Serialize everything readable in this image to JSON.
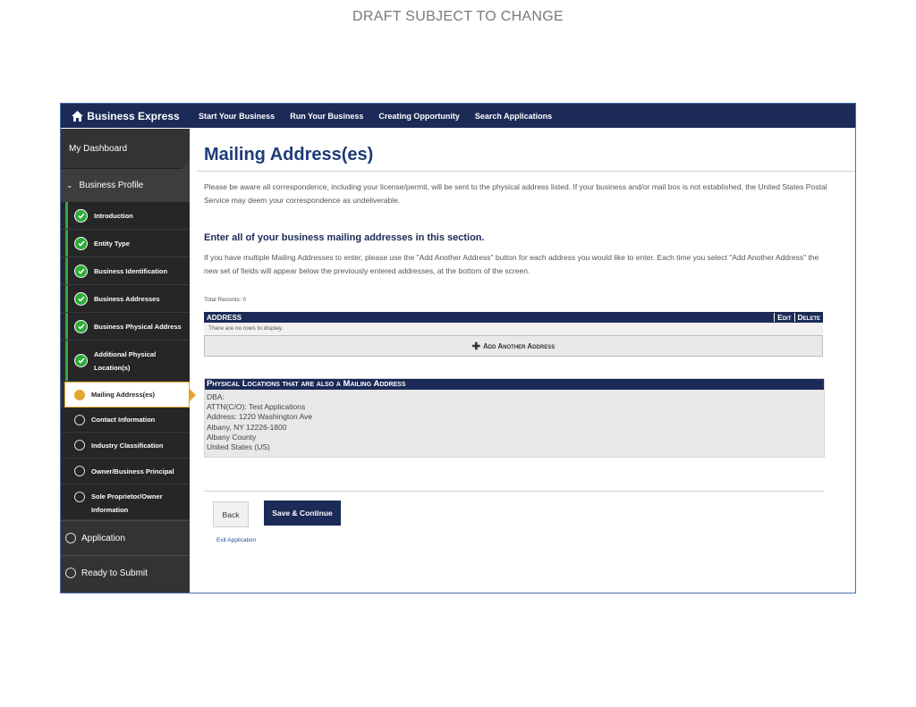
{
  "banner": "DRAFT SUBJECT TO CHANGE",
  "topnav": {
    "brand": "Business Express",
    "links": [
      "Start Your Business",
      "Run Your Business",
      "Creating Opportunity",
      "Search Applications"
    ]
  },
  "sidebar": {
    "dashboard": "My Dashboard",
    "group": "Business Profile",
    "items": [
      {
        "label": "Introduction",
        "status": "complete"
      },
      {
        "label": "Entity Type",
        "status": "complete"
      },
      {
        "label": "Business Identification",
        "status": "complete"
      },
      {
        "label": "Business Addresses",
        "status": "complete"
      },
      {
        "label": "Business Physical Address",
        "status": "complete"
      },
      {
        "label": "Additional Physical Location(s)",
        "status": "complete"
      },
      {
        "label": "Mailing Address(es)",
        "status": "current"
      },
      {
        "label": "Contact Information",
        "status": "incomplete"
      },
      {
        "label": "Industry Classification",
        "status": "incomplete"
      },
      {
        "label": "Owner/Business Principal",
        "status": "incomplete"
      },
      {
        "label": "Sole Proprietor/Owner Information",
        "status": "incomplete"
      }
    ],
    "application": "Application",
    "ready": "Ready to Submit"
  },
  "main": {
    "title": "Mailing Address(es)",
    "notice": "Please be aware all correspondence, including your license/permit, will be sent to the physical address listed. If your business and/or mail box is not established, the United States Postal Service may deem your correspondence as undeliverable.",
    "section_heading": "Enter all of your business mailing addresses in this section.",
    "instructions": "If you have multiple Mailing Addresses to enter, please use the \"Add Another Address\" button for each address you would like to enter. Each time you select \"Add Another Address\" the new set of fields will appear below the previously entered addresses, at the bottom of the screen.",
    "total_records": "Total Records: 0",
    "grid": {
      "col_address": "ADDRESS",
      "col_edit": "Edit",
      "col_delete": "Delete",
      "empty": "There are no rows to display.",
      "add_button": "Add Another Address"
    },
    "physical": {
      "heading": "Physical Locations that are also a Mailing Address",
      "lines": [
        "DBA:",
        "ATTN(C/O): Test Applications",
        "Address: 1220 Washington Ave",
        "Albany, NY 12226-1800",
        "Albany County",
        "United States (US)"
      ]
    },
    "back": "Back",
    "save": "Save & Continue",
    "exit": "Exit Application"
  },
  "colors": {
    "navy": "#1b2a56",
    "title_blue": "#1d3c78",
    "complete_green": "#2eaa3a",
    "current_gold": "#e4a72c"
  }
}
